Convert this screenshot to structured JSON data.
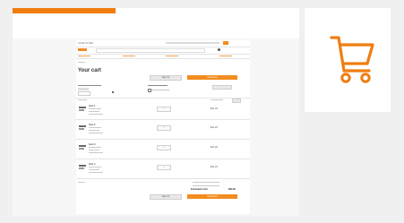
{
  "page": {
    "accent": "#f07d10",
    "icon": "shopping-cart-icon"
  },
  "shop": {
    "title": "Your cart",
    "brand": "ACME STORE",
    "top_btn_left": "Sign Up",
    "top_btn_right": "Check Out",
    "bottom_btn_left": "Sign Up",
    "bottom_btn_right": "Check Out",
    "total_label": "Estimated total",
    "total_value": "$84.80",
    "items": [
      {
        "name": "Item 1",
        "qty": "1",
        "price": "$21.20"
      },
      {
        "name": "Item 2",
        "qty": "1",
        "price": "$21.20"
      },
      {
        "name": "Item 3",
        "qty": "1",
        "price": "$21.20"
      },
      {
        "name": "Item 4",
        "qty": "1",
        "price": "$21.20"
      }
    ]
  }
}
